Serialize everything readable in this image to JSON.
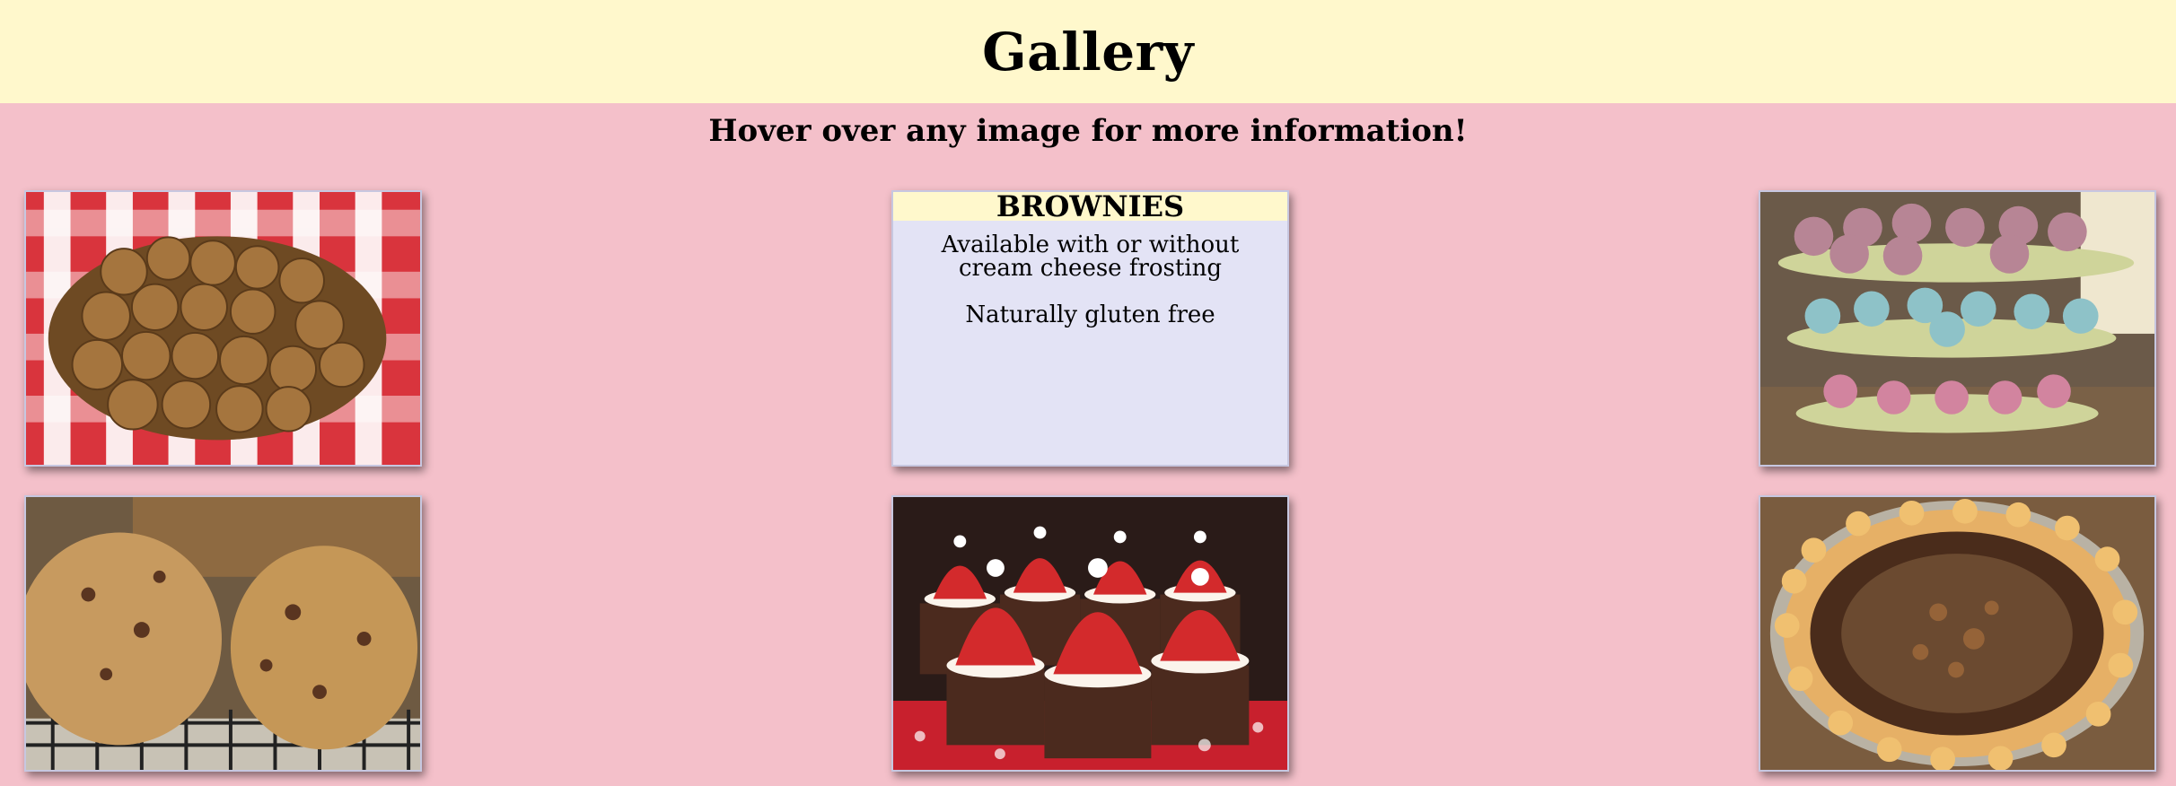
{
  "header": {
    "title": "Gallery"
  },
  "subtitle": "Hover over any image for more information!",
  "gallery": {
    "items": [
      {
        "image": "cookies-in-basket-photo"
      },
      {
        "hovered": true,
        "title": "BROWNIES",
        "lines": [
          "Available with or without cream cheese frosting",
          "Naturally gluten free"
        ]
      },
      {
        "image": "cupcake-tower-photo"
      },
      {
        "image": "large-chocolate-chip-cookies-photo"
      },
      {
        "image": "strawberry-santa-brownies-photo"
      },
      {
        "image": "peanut-butter-cup-pie-photo"
      }
    ]
  },
  "colors": {
    "background": "#f4c0ca",
    "header": "#fff8cc",
    "info_panel": "#e3e3f5"
  }
}
